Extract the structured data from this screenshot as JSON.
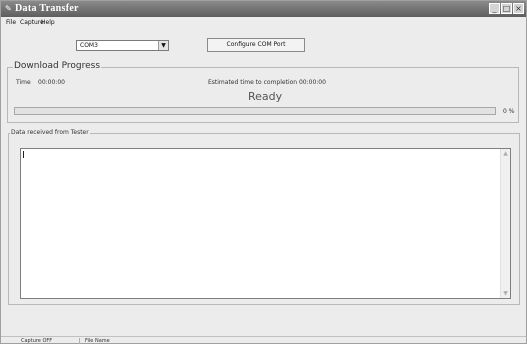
{
  "window": {
    "title": "Data Transfer",
    "controls": {
      "minimize": "_",
      "maximize": "□",
      "close": "×"
    }
  },
  "menu": [
    "File",
    "Capture",
    "Help"
  ],
  "port": {
    "selected": "COM3",
    "configure_label": "Configure COM Port"
  },
  "download": {
    "group_label": "Download Progress",
    "time_label": "Time",
    "time_value": "00:00:00",
    "eta_text": "Estimated time to completion 00:00:00",
    "status": "Ready",
    "progress_percent": 0,
    "progress_text": "0 %"
  },
  "received": {
    "group_label": "Data received from Tester",
    "content": ""
  },
  "statusbar": {
    "capture": "Capture OFF",
    "file": "File Name"
  },
  "colors": {
    "titlebar": "#6e6e6e",
    "window_bg": "#ececec",
    "progress_fill": "#4a6fa5"
  },
  "icons": {
    "app": "wrench-icon",
    "combo_arrow": "chevron-down-icon"
  }
}
